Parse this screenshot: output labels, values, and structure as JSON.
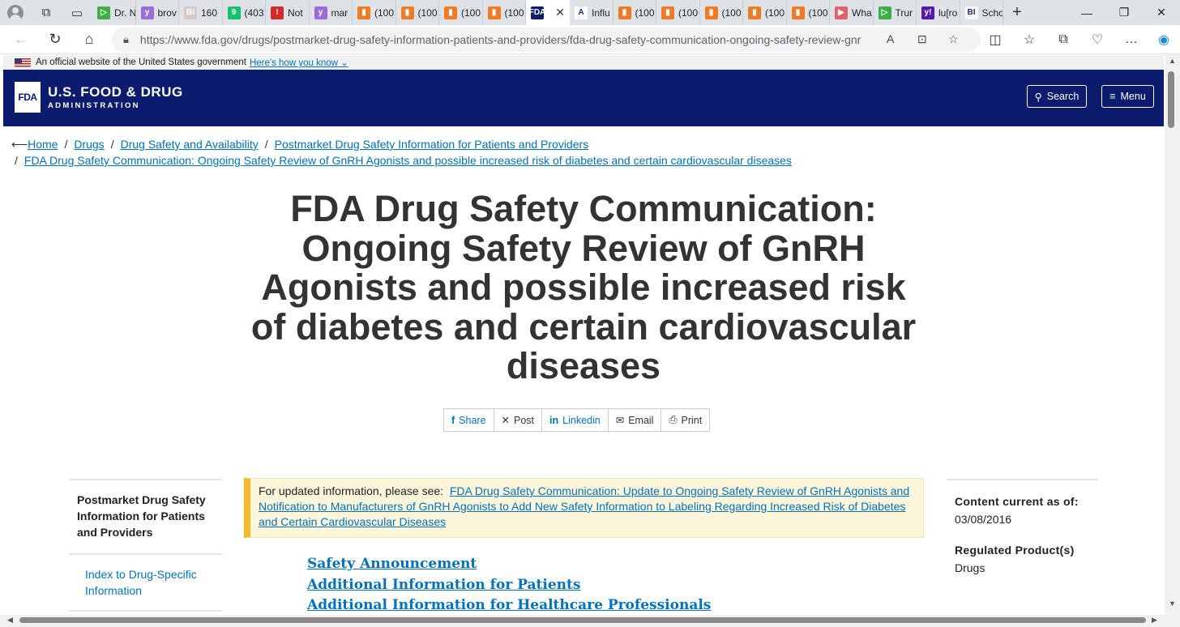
{
  "browser": {
    "tabs": [
      {
        "label": "Dr. N",
        "fav": "#3fae49",
        "sym": "▷"
      },
      {
        "label": "brov",
        "fav": "#9b6dd6",
        "sym": "y"
      },
      {
        "label": "160",
        "fav": "#d8c9c9",
        "sym": "BI"
      },
      {
        "label": "(403",
        "fav": "#18c06a",
        "sym": "9"
      },
      {
        "label": "Not",
        "fav": "#d12b2b",
        "sym": "!"
      },
      {
        "label": "mar",
        "fav": "#9b6dd6",
        "sym": "y"
      },
      {
        "label": "(100",
        "fav": "#f07b26",
        "sym": "▮"
      },
      {
        "label": "(100",
        "fav": "#f07b26",
        "sym": "▮"
      },
      {
        "label": "(100",
        "fav": "#f07b26",
        "sym": "▮"
      },
      {
        "label": "(100",
        "fav": "#f07b26",
        "sym": "▮"
      },
      {
        "label": "",
        "fav": "#0b1c6e",
        "sym": "FDA",
        "active": true
      },
      {
        "label": "Influ",
        "fav": "#ffffff",
        "sym": "A"
      },
      {
        "label": "(100",
        "fav": "#f07b26",
        "sym": "▮"
      },
      {
        "label": "(100",
        "fav": "#f07b26",
        "sym": "▮"
      },
      {
        "label": "(100",
        "fav": "#f07b26",
        "sym": "▮"
      },
      {
        "label": "(100",
        "fav": "#f07b26",
        "sym": "▮"
      },
      {
        "label": "(100",
        "fav": "#f07b26",
        "sym": "▮"
      },
      {
        "label": "Wha",
        "fav": "#e0626b",
        "sym": "▶"
      },
      {
        "label": "Trur",
        "fav": "#3fae49",
        "sym": "▷"
      },
      {
        "label": "lu[ro",
        "fav": "#5a16a6",
        "sym": "y!"
      },
      {
        "label": "Scho",
        "fav": "#ffffff",
        "sym": "BI"
      }
    ],
    "url": "https://www.fda.gov/drugs/postmarket-drug-safety-information-patients-and-providers/fda-drug-safety-communication-ongoing-safety-review-gnrh-a..."
  },
  "gov_banner": {
    "text": "An official website of the United States government",
    "link": "Here's how you know"
  },
  "header": {
    "logo_mark": "FDA",
    "logo_line1": "U.S. FOOD & DRUG",
    "logo_line2": "ADMINISTRATION",
    "search_label": "Search",
    "menu_label": "Menu"
  },
  "breadcrumbs": [
    "Home",
    "Drugs",
    "Drug Safety and Availability",
    "Postmarket Drug Safety Information for Patients and Providers",
    "FDA Drug Safety Communication: Ongoing Safety Review of GnRH Agonists and possible increased risk of diabetes and certain cardiovascular diseases"
  ],
  "page_title": "FDA Drug Safety Communication: Ongoing Safety Review of GnRH Agonists and possible increased risk of diabetes and certain cardiovascular diseases",
  "share": {
    "facebook": "Share",
    "x": "Post",
    "linkedin": "Linkedin",
    "email": "Email",
    "print": "Print"
  },
  "sidebar": {
    "heading": "Postmarket Drug Safety Information for Patients and Providers",
    "items": [
      "Index to Drug-Specific Information"
    ]
  },
  "alert": {
    "prefix": "For updated information, please see:",
    "link": "FDA Drug Safety Communication: Update to Ongoing Safety Review of GnRH Agonists and Notification to Manufacturers of GnRH Agonists to Add New Safety Information to Labeling Regarding Increased Risk of Diabetes and Certain Cardiovascular Diseases"
  },
  "toc": [
    "Safety Announcement",
    "Additional Information for Patients",
    "Additional Information for Healthcare Professionals"
  ],
  "meta": {
    "content_label": "Content current as of:",
    "content_date": "03/08/2016",
    "regulated_label": "Regulated Product(s)",
    "regulated_value": "Drugs"
  }
}
